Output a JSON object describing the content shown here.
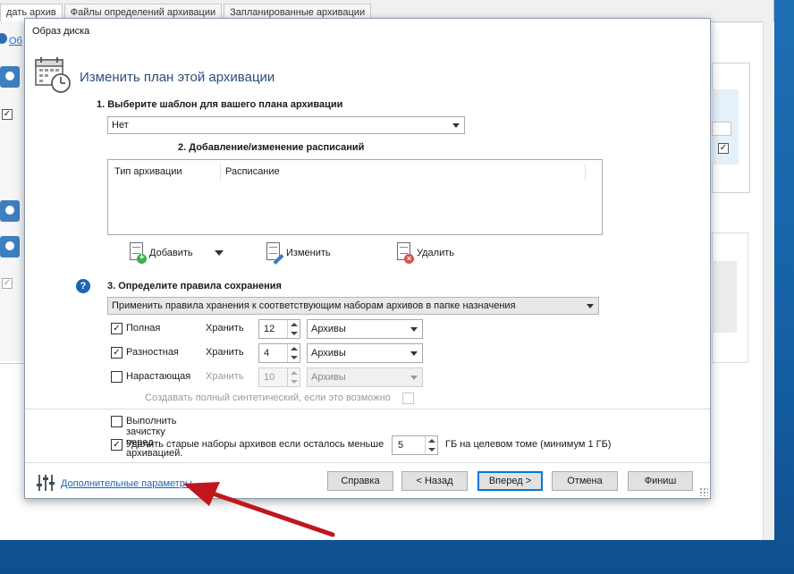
{
  "background_app": {
    "tabs": [
      "дать архив",
      "Файлы определений архивации",
      "Запланированные архивации"
    ],
    "link_text": "Об"
  },
  "dialog": {
    "title": "Образ диска",
    "header_title": "Изменить план этой архивации",
    "section1": {
      "label": "1. Выберите шаблон для вашего плана архивации",
      "template_value": "Нет"
    },
    "section2": {
      "label": "2. Добавление/изменение расписаний",
      "columns": [
        "Тип архивации",
        "Расписание"
      ],
      "rows": [],
      "buttons": {
        "add": "Добавить",
        "edit": "Изменить",
        "delete": "Удалить"
      }
    },
    "section3": {
      "label": "3. Определите правила сохранения",
      "retention_rule": "Применить правила хранения к соответствующим наборам архивов в папке назначения",
      "rows": [
        {
          "label": "Полная",
          "checked": true,
          "keep_label": "Хранить",
          "count": "12",
          "unit": "Архивы",
          "enabled": true
        },
        {
          "label": "Разностная",
          "checked": true,
          "keep_label": "Хранить",
          "count": "4",
          "unit": "Архивы",
          "enabled": true
        },
        {
          "label": "Нарастающая",
          "checked": false,
          "keep_label": "Хранить",
          "count": "10",
          "unit": "Архивы",
          "enabled": false
        }
      ],
      "synthetic_label": "Создавать полный синтетический, если это возможно"
    },
    "options": {
      "cleanup_label": "Выполнить зачистку перед архивацией.",
      "cleanup_checked": false,
      "delete_old_label": "Удалить старые наборы архивов если осталось меньше",
      "delete_old_checked": true,
      "gb_value": "5",
      "gb_suffix": "ГБ на целевом томе (минимум 1 ГБ)"
    },
    "footer": {
      "advanced_link": "Дополнительные параметры",
      "buttons": {
        "help": "Справка",
        "back": "< Назад",
        "next": "Вперед >",
        "cancel": "Отмена",
        "finish": "Финиш"
      }
    }
  },
  "colors": {
    "accent": "#0078d7",
    "link": "#1a64b5",
    "annotation_arrow": "#c0161c"
  },
  "icons": {
    "header": "calendar-clock-icon",
    "help": "question-icon",
    "settings": "sliders-icon",
    "add": "document-add-icon",
    "edit": "document-edit-icon",
    "delete": "document-delete-icon"
  }
}
